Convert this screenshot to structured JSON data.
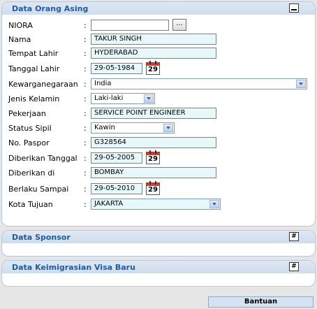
{
  "panels": {
    "orang_asing": {
      "title": "Data Orang Asing"
    },
    "sponsor": {
      "title": "Data Sponsor",
      "toggle": "#"
    },
    "keimigrasian": {
      "title": "Data Keimigrasian Visa Baru",
      "toggle": "#"
    }
  },
  "form": {
    "niora": {
      "label": "NIORA",
      "value": "",
      "browse": "..."
    },
    "nama": {
      "label": "Nama",
      "value": "TAKUR SINGH"
    },
    "tempat_lahir": {
      "label": "Tempat Lahir",
      "value": "HYDERABAD"
    },
    "tanggal_lahir": {
      "label": "Tanggal Lahir",
      "value": "29-05-1984"
    },
    "kewarganegaraan": {
      "label": "Kewarganegaraan",
      "value": "India"
    },
    "jenis_kelamin": {
      "label": "Jenis Kelamin",
      "value": "Laki-laki"
    },
    "pekerjaan": {
      "label": "Pekerjaan",
      "value": "SERVICE POINT ENGINEER"
    },
    "status_sipil": {
      "label": "Status Sipil",
      "value": "Kawin"
    },
    "no_paspor": {
      "label": "No. Paspor",
      "value": "G328564"
    },
    "diberikan_tanggal": {
      "label": "Diberikan Tanggal",
      "value": "29-05-2005"
    },
    "diberikan_di": {
      "label": "Diberikan di",
      "value": "BOMBAY"
    },
    "berlaku_sampai": {
      "label": "Berlaku Sampai",
      "value": "29-05-2010"
    },
    "kota_tujuan": {
      "label": "Kota Tujuan",
      "value": "JAKARTA"
    }
  },
  "colon": ":",
  "calendar_day": "29",
  "help_button": "Bantuan"
}
